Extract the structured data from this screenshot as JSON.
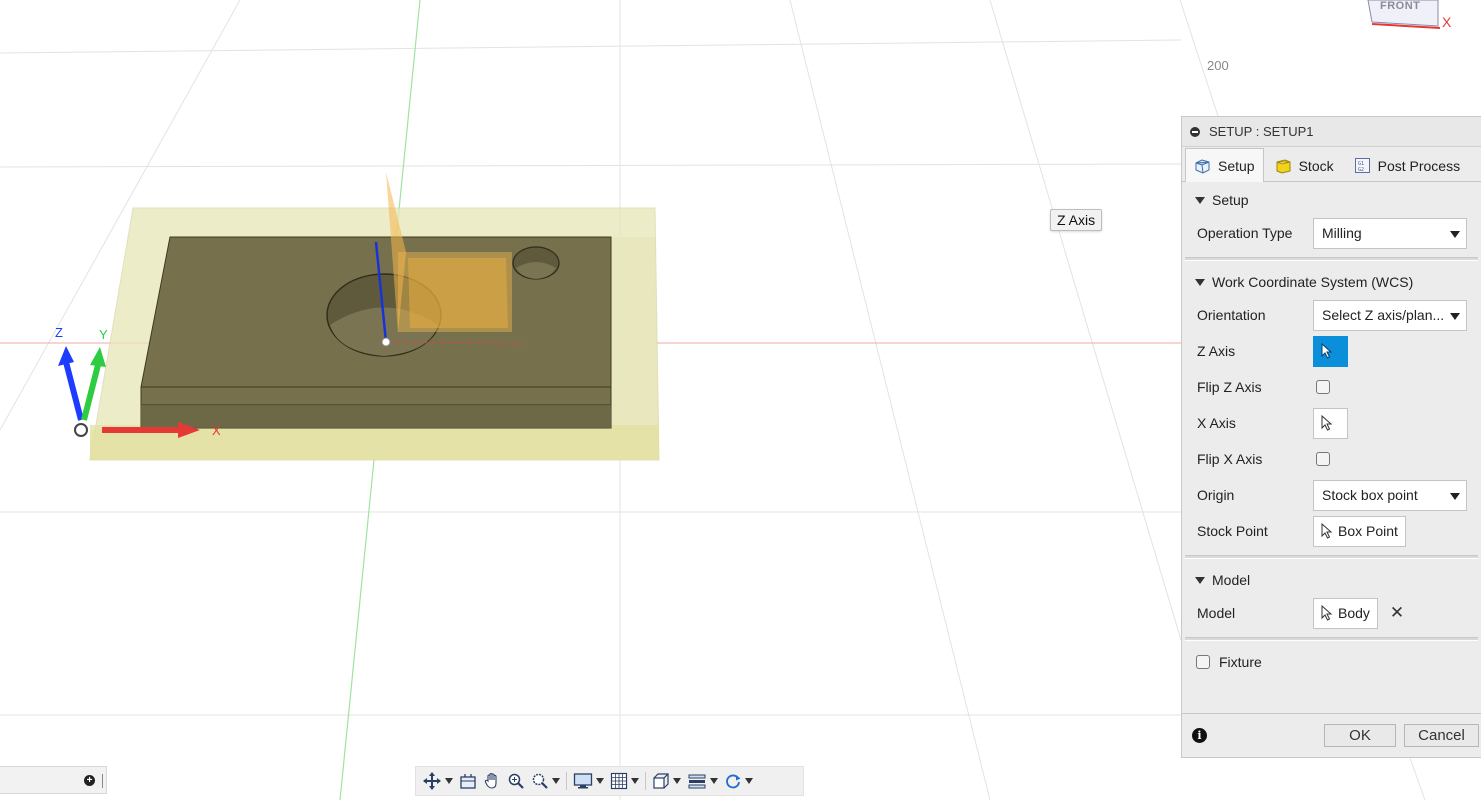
{
  "viewport": {
    "tooltip": "Z Axis",
    "viewcube_face": "FRONT",
    "viewcube_axis": "X",
    "ruler_label": "200",
    "triad": {
      "z": "Z",
      "y": "Y",
      "x": "X"
    }
  },
  "panel": {
    "title": "SETUP : SETUP1",
    "tabs": [
      {
        "label": "Setup",
        "icon": "setup-icon",
        "active": true
      },
      {
        "label": "Stock",
        "icon": "stock-cube-icon",
        "active": false
      },
      {
        "label": "Post Process",
        "icon": "post-process-icon",
        "active": false
      }
    ],
    "sections": {
      "setup": {
        "title": "Setup",
        "operation_type_label": "Operation Type",
        "operation_type_value": "Milling"
      },
      "wcs": {
        "title": "Work Coordinate System (WCS)",
        "orientation_label": "Orientation",
        "orientation_value": "Select Z axis/plan...",
        "z_axis_label": "Z Axis",
        "flip_z_label": "Flip Z Axis",
        "x_axis_label": "X Axis",
        "flip_x_label": "Flip X Axis",
        "origin_label": "Origin",
        "origin_value": "Stock box point",
        "stock_point_label": "Stock Point",
        "stock_point_value": "Box Point"
      },
      "model": {
        "title": "Model",
        "model_label": "Model",
        "model_value": "Body"
      },
      "fixture": {
        "label": "Fixture"
      }
    },
    "footer": {
      "info": "i",
      "ok": "OK",
      "cancel": "Cancel"
    }
  },
  "colors": {
    "accent": "#0b8fdb",
    "axis_x": "#e53935",
    "axis_y": "#2ecc40",
    "axis_z": "#1e3cff",
    "stock": "#e6e4b4",
    "part": "#6f6a48"
  },
  "bottom_left": {
    "plus_icon": "+"
  }
}
